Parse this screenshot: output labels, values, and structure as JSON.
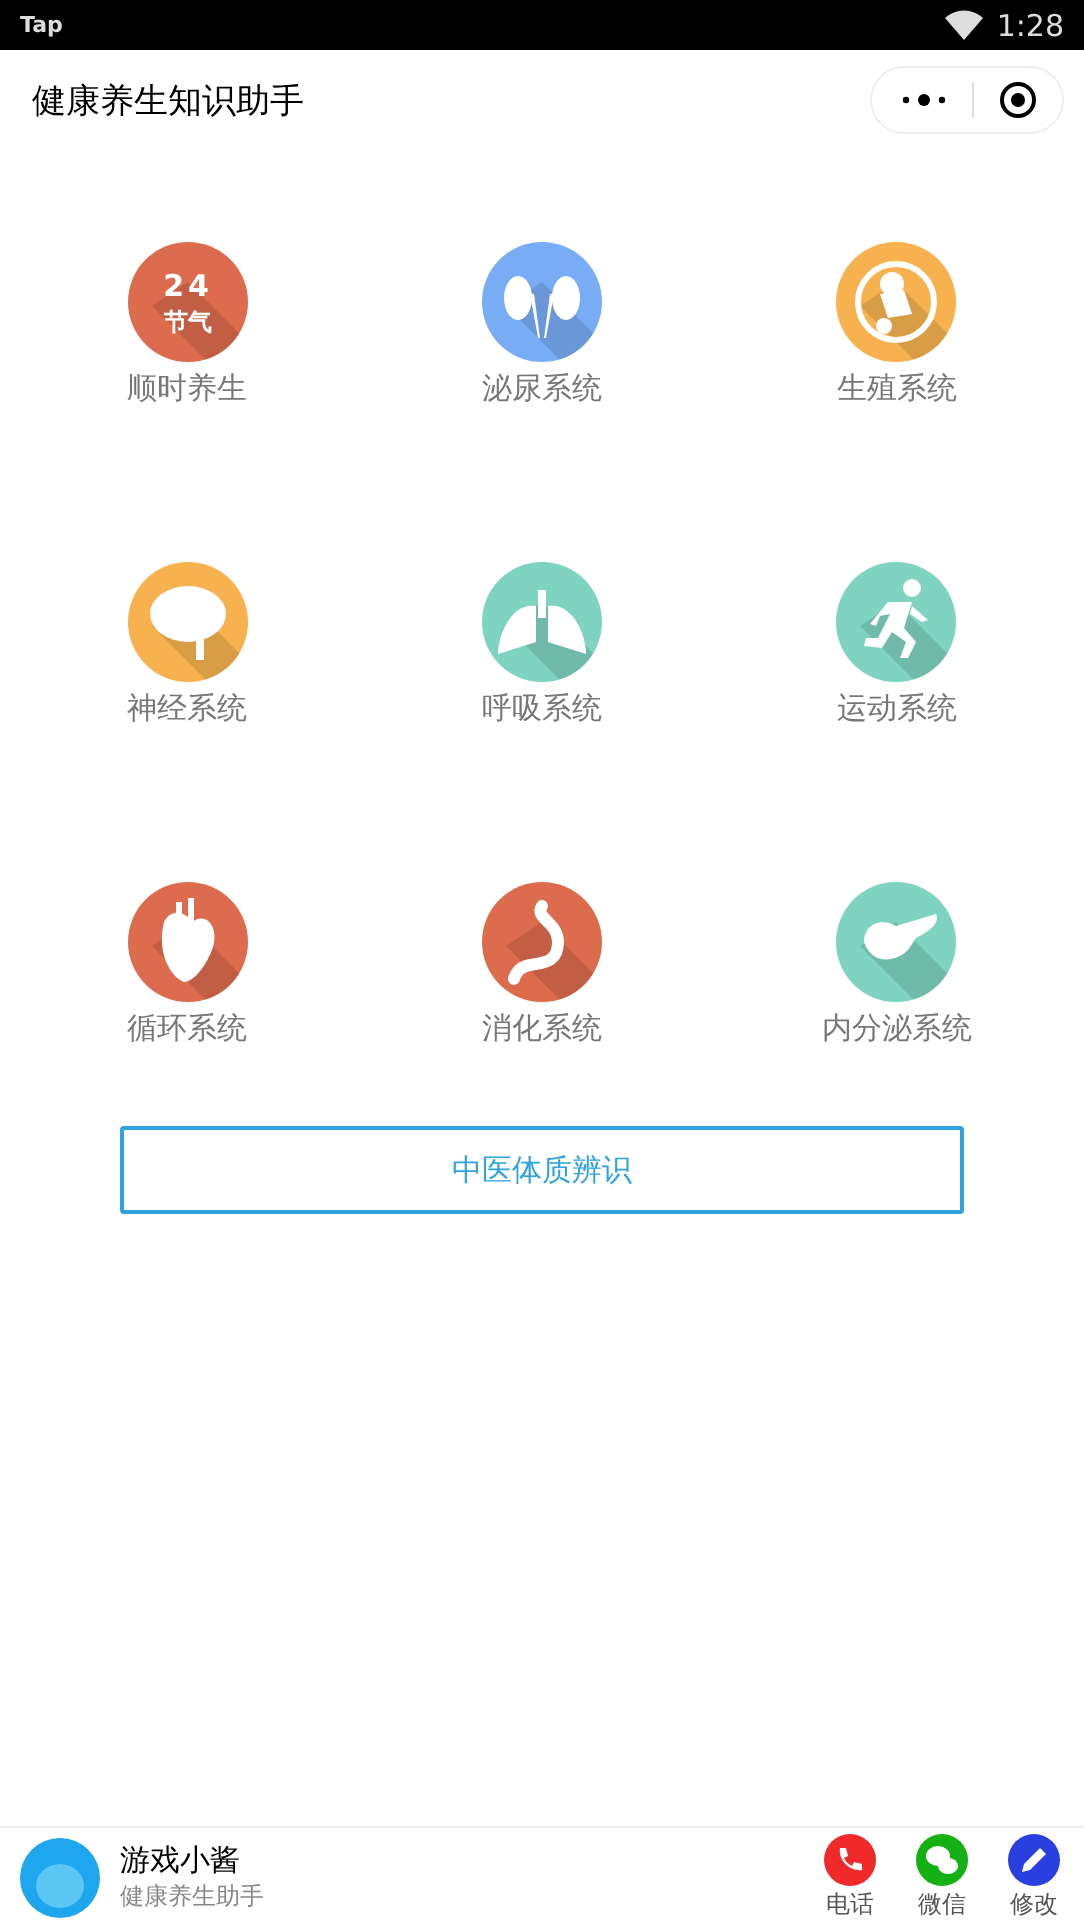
{
  "status_bar": {
    "carrier": "Tap",
    "time": "1:28"
  },
  "nav_bar": {
    "title": "健康养生知识助手"
  },
  "categories": [
    {
      "label": "顺时养生",
      "kind": "solar-terms",
      "color": "#dd6b4d",
      "icon_text": [
        "24",
        "节气"
      ]
    },
    {
      "label": "泌尿系统",
      "kind": "kidneys",
      "color": "#78acf5"
    },
    {
      "label": "生殖系统",
      "kind": "fetus",
      "color": "#f7b24f"
    },
    {
      "label": "神经系统",
      "kind": "brain",
      "color": "#f7b24f"
    },
    {
      "label": "呼吸系统",
      "kind": "lungs",
      "color": "#7fd3c1"
    },
    {
      "label": "运动系统",
      "kind": "runner",
      "color": "#7fd3c1"
    },
    {
      "label": "循环系统",
      "kind": "heart",
      "color": "#dd6b4d"
    },
    {
      "label": "消化系统",
      "kind": "stomach",
      "color": "#dd6b4d"
    },
    {
      "label": "内分泌系统",
      "kind": "pancreas",
      "color": "#7fd3c1"
    }
  ],
  "main_button": "中医体质辨识",
  "footer": {
    "name": "游戏小酱",
    "subtitle": "健康养生助手",
    "actions": [
      {
        "label": "电话",
        "kind": "phone",
        "color": "#f02a2a"
      },
      {
        "label": "微信",
        "kind": "wechat",
        "color": "#14b014"
      },
      {
        "label": "修改",
        "kind": "edit",
        "color": "#2a3fe0"
      }
    ]
  }
}
